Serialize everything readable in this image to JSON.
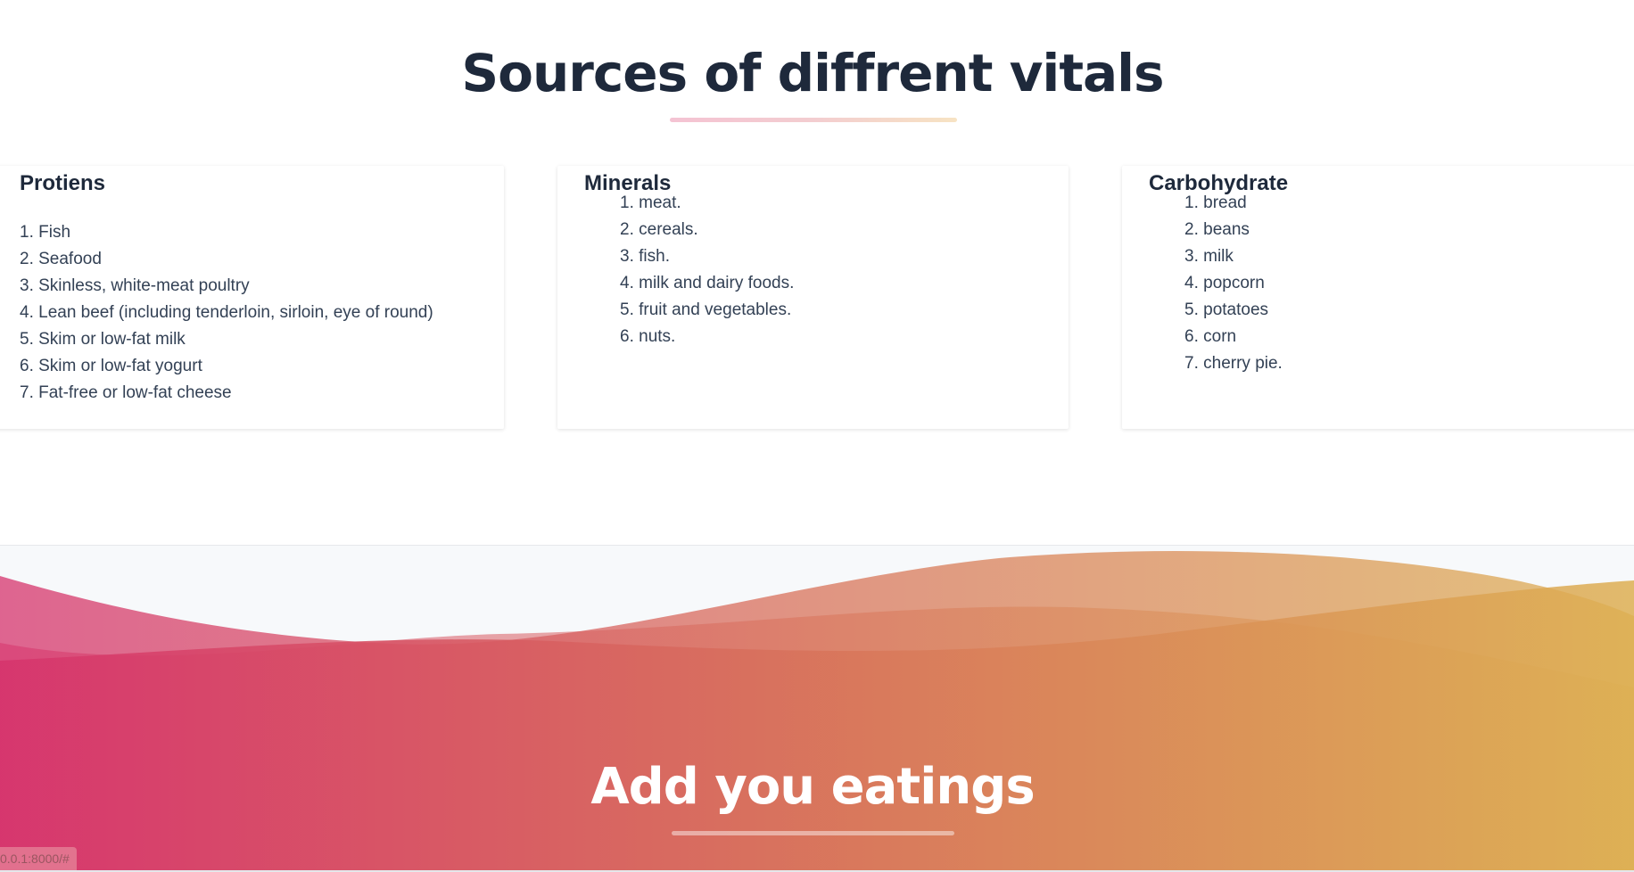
{
  "sources": {
    "title": "Sources of diffrent vitals",
    "cards": [
      {
        "title": "Protiens",
        "items": [
          "1. Fish",
          "2. Seafood",
          "3. Skinless, white-meat poultry",
          "4. Lean beef (including tenderloin, sirloin, eye of round)",
          "5. Skim or low-fat milk",
          "6. Skim or low-fat yogurt",
          "7. Fat-free or low-fat cheese"
        ]
      },
      {
        "title": "Minerals",
        "items": [
          "1. meat.",
          "2. cereals.",
          "3. fish.",
          "4. milk and dairy foods.",
          "5. fruit and vegetables.",
          "6. nuts."
        ]
      },
      {
        "title": "Carbohydrate",
        "items": [
          "1. bread",
          "2. beans",
          "3. milk",
          "4. popcorn",
          "5. potatoes",
          "6. corn",
          "7. cherry pie."
        ]
      }
    ]
  },
  "footer": {
    "title": "Add you eatings"
  },
  "status_bar": {
    "url": "0.0.1:8000/#"
  },
  "colors": {
    "gradient_start": "#d6336c",
    "gradient_end": "#ddaf52",
    "heading": "#1e293b"
  }
}
